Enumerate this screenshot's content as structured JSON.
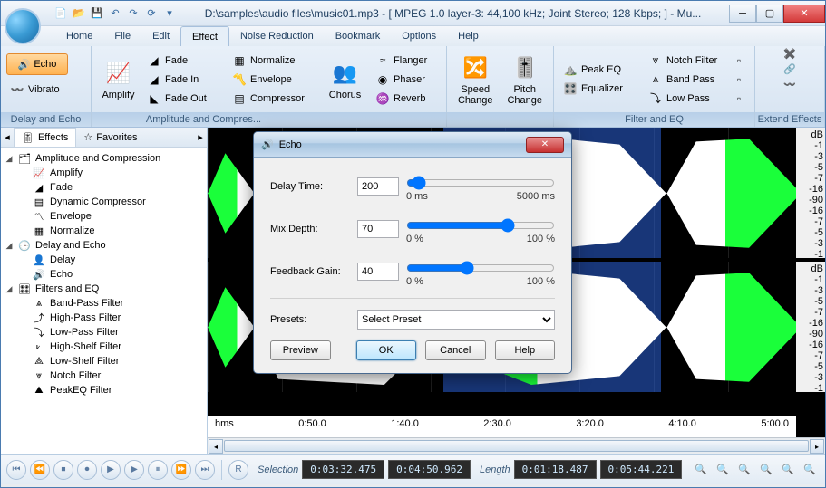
{
  "title": "D:\\samples\\audio files\\music01.mp3 - [ MPEG 1.0 layer-3: 44,100 kHz; Joint Stereo; 128 Kbps;  ] - Mu...",
  "menus": [
    "Home",
    "File",
    "Edit",
    "Effect",
    "Noise Reduction",
    "Bookmark",
    "Options",
    "Help"
  ],
  "active_menu": "Effect",
  "ribbon": {
    "group1": {
      "title": "Delay and Echo",
      "echo": "Echo",
      "vibrato": "Vibrato"
    },
    "group2": {
      "title": "Amplitude and Compres...",
      "amplify": "Amplify",
      "fade": "Fade",
      "fadein": "Fade In",
      "fadeout": "Fade Out",
      "normalize": "Normalize",
      "envelope": "Envelope",
      "compressor": "Compressor"
    },
    "group3": {
      "title": "",
      "chorus": "Chorus",
      "flanger": "Flanger",
      "phaser": "Phaser",
      "reverb": "Reverb"
    },
    "group4": {
      "title": "",
      "speed": "Speed\nChange",
      "pitch": "Pitch\nChange"
    },
    "group5": {
      "title": "Filter and EQ",
      "peakeq": "Peak EQ",
      "equalizer": "Equalizer",
      "notch": "Notch Filter",
      "bandpass": "Band Pass",
      "lowpass": "Low Pass"
    },
    "group6": {
      "title": "Extend Effects"
    }
  },
  "side_tabs": {
    "effects": "Effects",
    "favorites": "Favorites"
  },
  "tree": {
    "g1": "Amplitude and Compression",
    "g1_items": [
      "Amplify",
      "Fade",
      "Dynamic Compressor",
      "Envelope",
      "Normalize"
    ],
    "g2": "Delay and Echo",
    "g2_items": [
      "Delay",
      "Echo"
    ],
    "g3": "Filters and EQ",
    "g3_items": [
      "Band-Pass Filter",
      "High-Pass Filter",
      "Low-Pass Filter",
      "High-Shelf Filter",
      "Low-Shelf Filter",
      "Notch Filter",
      "PeakEQ Filter"
    ]
  },
  "db_labels": [
    "dB",
    "-1",
    "-3",
    "-5",
    "-7",
    "-16",
    "-90",
    "-16",
    "-7",
    "-5",
    "-3",
    "-1"
  ],
  "time_ticks": [
    "hms",
    "0:50.0",
    "1:40.0",
    "2:30.0",
    "3:20.0",
    "4:10.0",
    "5:00.0"
  ],
  "transport": {
    "selection_label": "Selection",
    "sel_start": "0:03:32.475",
    "sel_end": "0:04:50.962",
    "length_label": "Length",
    "len_a": "0:01:18.487",
    "len_b": "0:05:44.221"
  },
  "dialog": {
    "title": "Echo",
    "delay_label": "Delay Time:",
    "delay_value": "200",
    "delay_min": "0 ms",
    "delay_max": "5000 ms",
    "mix_label": "Mix Depth:",
    "mix_value": "70",
    "mix_min": "0 %",
    "mix_max": "100 %",
    "fb_label": "Feedback Gain:",
    "fb_value": "40",
    "fb_min": "0 %",
    "fb_max": "100 %",
    "presets_label": "Presets:",
    "presets_value": "Select Preset",
    "btn_preview": "Preview",
    "btn_ok": "OK",
    "btn_cancel": "Cancel",
    "btn_help": "Help"
  }
}
